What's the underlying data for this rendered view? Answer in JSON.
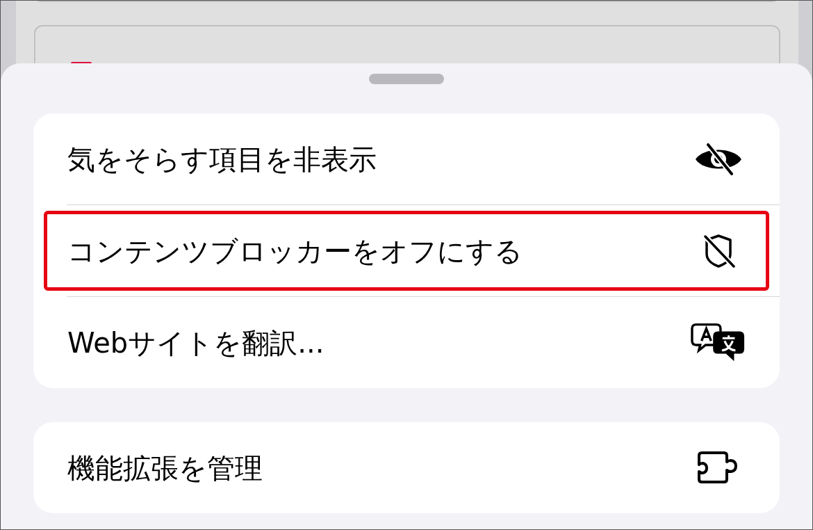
{
  "groups": [
    {
      "items": [
        {
          "label": "気をそらす項目を非表示",
          "kind": "eye-slash",
          "highlighted": false
        },
        {
          "label": "コンテンツブロッカーをオフにする",
          "kind": "shield-slash",
          "highlighted": true
        },
        {
          "label": "Webサイトを翻訳...",
          "kind": "translate",
          "highlighted": false
        }
      ]
    },
    {
      "items": [
        {
          "label": "機能拡張を管理",
          "kind": "puzzle",
          "highlighted": false
        }
      ]
    }
  ]
}
